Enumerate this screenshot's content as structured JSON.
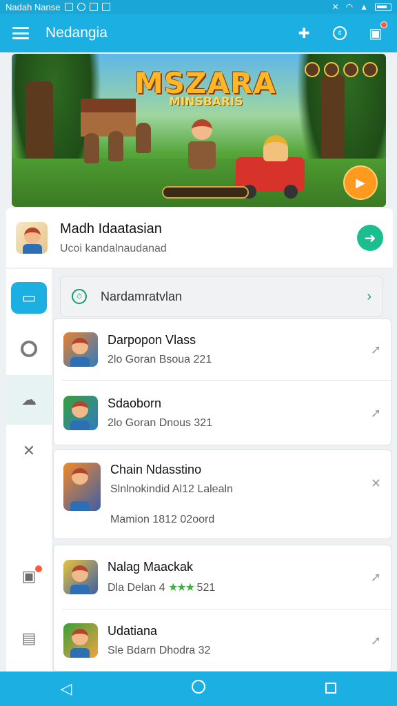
{
  "status_bar": {
    "left_text": "Nadah Nanse"
  },
  "app_bar": {
    "title": "Nedangia"
  },
  "banner": {
    "title": "MSZARA",
    "subtitle": "MINSBARIS"
  },
  "featured": {
    "title": "Madh Idaatasian",
    "subtitle": "Ucoi kandalnaudanad"
  },
  "filter": {
    "label": "Nardamratvlan"
  },
  "list": [
    {
      "title": "Darpopon Vlass",
      "subtitle": "2lo Goran Bsoua 221",
      "colors": [
        "#e7812f",
        "#2e7cc4"
      ]
    },
    {
      "title": "Sdaoborn",
      "subtitle": "2lo Goran Dnous 321",
      "colors": [
        "#3c9e3c",
        "#2e7cc4"
      ]
    },
    {
      "title": "Chain Ndasstino",
      "subtitle": "Slnlnokindid Al12 Lalealn",
      "extra": "Mamion 1812 02oord",
      "colors": [
        "#f08a2a",
        "#3b5fa8"
      ]
    },
    {
      "title": "Nalag Maackak",
      "subtitle": "Dla Delan 4",
      "rating_suffix": "521",
      "colors": [
        "#e9c23c",
        "#3b5fa8"
      ]
    },
    {
      "title": "Udatiana",
      "subtitle": "Sle Bdarn Dhodra 32",
      "colors": [
        "#3a9e3a",
        "#f0a342"
      ]
    }
  ],
  "colors": {
    "accent": "#1cb0e2",
    "go": "#1bbf8f",
    "badge": "#ff5a3c"
  },
  "icons": {
    "app_actions": [
      "puzzle-icon",
      "coin-icon",
      "gift-icon"
    ],
    "side_nav": [
      "wallet-icon",
      "ring-icon",
      "cloud-icon",
      "close-icon",
      "gift-icon",
      "document-icon"
    ],
    "bottom_nav": [
      "back-icon",
      "home-icon",
      "recent-apps-icon"
    ]
  }
}
